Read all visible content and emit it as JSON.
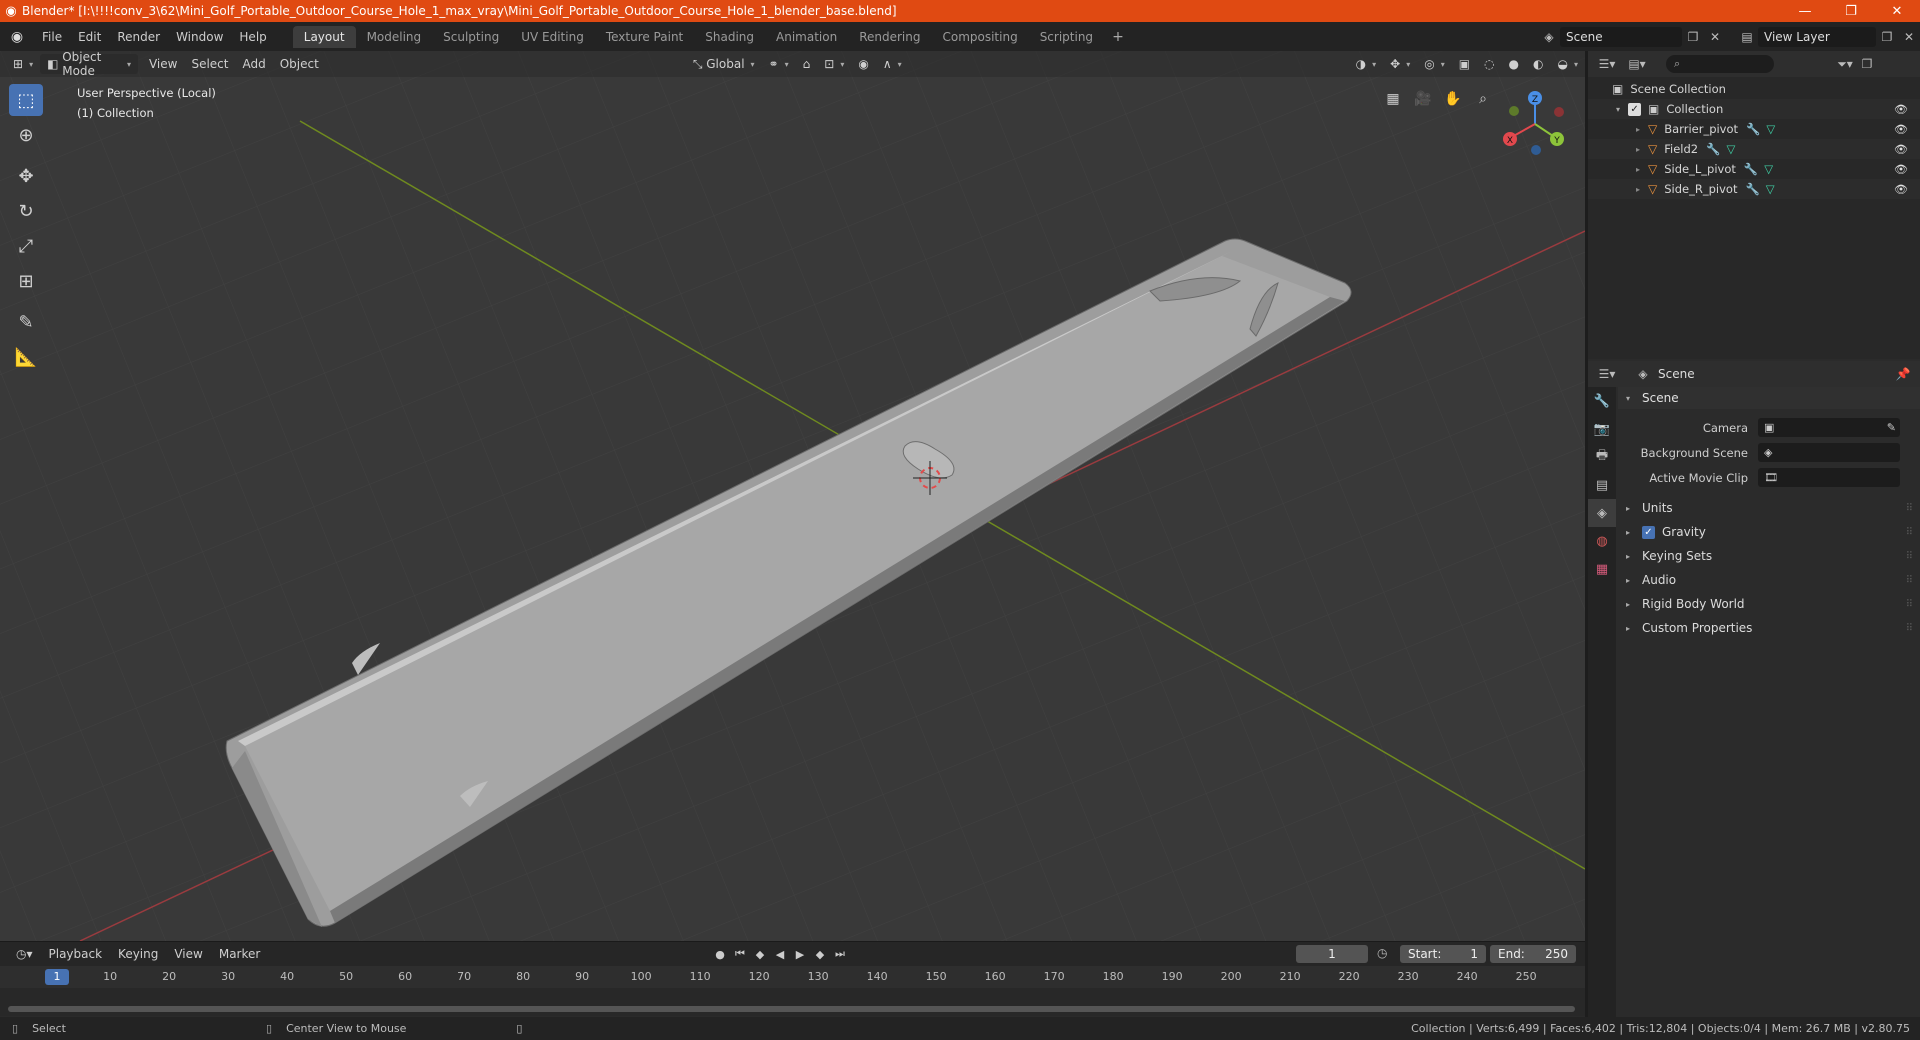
{
  "window": {
    "title": "Blender* [I:\\!!!!conv_3\\62\\Mini_Golf_Portable_Outdoor_Course_Hole_1_max_vray\\Mini_Golf_Portable_Outdoor_Course_Hole_1_blender_base.blend]",
    "controls": {
      "minimize": "—",
      "maximize": "❐",
      "close": "✕"
    }
  },
  "menu": {
    "items": [
      "File",
      "Edit",
      "Render",
      "Window",
      "Help"
    ]
  },
  "workspaces": {
    "tabs": [
      "Layout",
      "Modeling",
      "Sculpting",
      "UV Editing",
      "Texture Paint",
      "Shading",
      "Animation",
      "Rendering",
      "Compositing",
      "Scripting"
    ],
    "active": "Layout",
    "add": "+"
  },
  "top_right": {
    "scene": "Scene",
    "view_layer": "View Layer"
  },
  "viewport": {
    "mode": "Object Mode",
    "menus": [
      "View",
      "Select",
      "Add",
      "Object"
    ],
    "orientation": "Global",
    "info_line1": "User Perspective (Local)",
    "info_line2": "(1) Collection",
    "gizmo": {
      "x": "X",
      "y": "Y",
      "z": "Z"
    }
  },
  "timeline": {
    "menus": [
      "Playback",
      "Keying",
      "View",
      "Marker"
    ],
    "current_frame": "1",
    "start_label": "Start:",
    "start": "1",
    "end_label": "End:",
    "end": "250",
    "ticks": [
      "1",
      "10",
      "20",
      "30",
      "40",
      "50",
      "60",
      "70",
      "80",
      "90",
      "100",
      "110",
      "120",
      "130",
      "140",
      "150",
      "160",
      "170",
      "180",
      "190",
      "200",
      "210",
      "220",
      "230",
      "240",
      "250"
    ]
  },
  "statusbar": {
    "select": "Select",
    "center_view": "Center View to Mouse",
    "stats": "Collection | Verts:6,499 | Faces:6,402 | Tris:12,804 | Objects:0/4 | Mem: 26.7 MB | v2.80.75"
  },
  "outliner": {
    "root": "Scene Collection",
    "collection": "Collection",
    "objects": [
      "Barrier_pivot",
      "Field2",
      "Side_L_pivot",
      "Side_R_pivot"
    ]
  },
  "properties": {
    "header": "Scene",
    "panel_title": "Scene",
    "camera_label": "Camera",
    "background_scene_label": "Background Scene",
    "active_movie_clip_label": "Active Movie Clip",
    "sub_panels": {
      "units": "Units",
      "gravity": "Gravity",
      "keying_sets": "Keying Sets",
      "audio": "Audio",
      "rigid_body_world": "Rigid Body World",
      "custom_properties": "Custom Properties"
    },
    "gravity_checked": true
  },
  "colors": {
    "titlebar": "#e04a12",
    "accent": "#4772b3",
    "viewport_bg": "#393939",
    "x_axis": "#e2484d",
    "y_axis": "#8dc43a",
    "z_axis": "#4a8fe7",
    "object_icon": "#e8913e"
  }
}
